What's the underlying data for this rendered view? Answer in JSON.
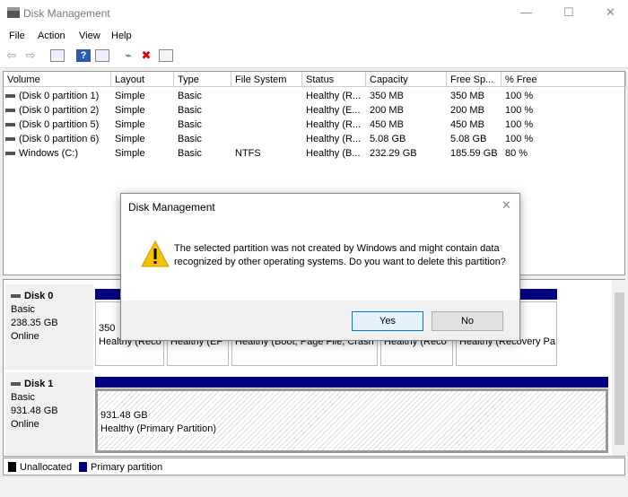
{
  "window": {
    "title": "Disk Management",
    "minimize": "—",
    "maximize": "☐",
    "close": "✕"
  },
  "menu": [
    "File",
    "Action",
    "View",
    "Help"
  ],
  "toolbar": {
    "icons": [
      "back-icon",
      "forward-icon",
      "console-tree-icon",
      "help-icon",
      "properties-icon",
      "connect-icon",
      "delete-icon",
      "settings-icon"
    ],
    "back": "⇦",
    "forward": "⇨",
    "help": "?",
    "delete": "✖"
  },
  "table": {
    "columns": [
      "Volume",
      "Layout",
      "Type",
      "File System",
      "Status",
      "Capacity",
      "Free Sp...",
      "% Free"
    ],
    "rows": [
      [
        "(Disk 0 partition 1)",
        "Simple",
        "Basic",
        "",
        "Healthy (R...",
        "350 MB",
        "350 MB",
        "100 %"
      ],
      [
        "(Disk 0 partition 2)",
        "Simple",
        "Basic",
        "",
        "Healthy (E...",
        "200 MB",
        "200 MB",
        "100 %"
      ],
      [
        "(Disk 0 partition 5)",
        "Simple",
        "Basic",
        "",
        "Healthy (R...",
        "450 MB",
        "450 MB",
        "100 %"
      ],
      [
        "(Disk 0 partition 6)",
        "Simple",
        "Basic",
        "",
        "Healthy (R...",
        "5.08 GB",
        "5.08 GB",
        "100 %"
      ],
      [
        "Windows (C:)",
        "Simple",
        "Basic",
        "NTFS",
        "Healthy (B...",
        "232.29 GB",
        "185.59 GB",
        "80 %"
      ]
    ]
  },
  "disks": [
    {
      "name": "Disk 0",
      "type": "Basic",
      "size": "238.35 GB",
      "status": "Online",
      "partitions": [
        {
          "size": "350",
          "status": "Healthy (Reco"
        },
        {
          "size": "",
          "status": "Healthy (EF"
        },
        {
          "size": "",
          "status": "Healthy (Boot, Page File, Crash"
        },
        {
          "size": "",
          "status": "Healthy (Reco"
        },
        {
          "size": "",
          "status": "Healthy (Recovery Pa"
        }
      ]
    },
    {
      "name": "Disk 1",
      "type": "Basic",
      "size": "931.48 GB",
      "status": "Online",
      "partitions": [
        {
          "size": "931.48 GB",
          "status": "Healthy (Primary Partition)"
        }
      ]
    }
  ],
  "legend": [
    {
      "label": "Unallocated",
      "color": "#000000"
    },
    {
      "label": "Primary partition",
      "color": "#000080"
    }
  ],
  "dialog": {
    "title": "Disk Management",
    "icon": "warning-icon",
    "message": "The selected partition was not created by Windows and might contain data recognized by other operating systems. Do you want to delete this partition?",
    "yes": "Yes",
    "no": "No",
    "close": "✕"
  }
}
